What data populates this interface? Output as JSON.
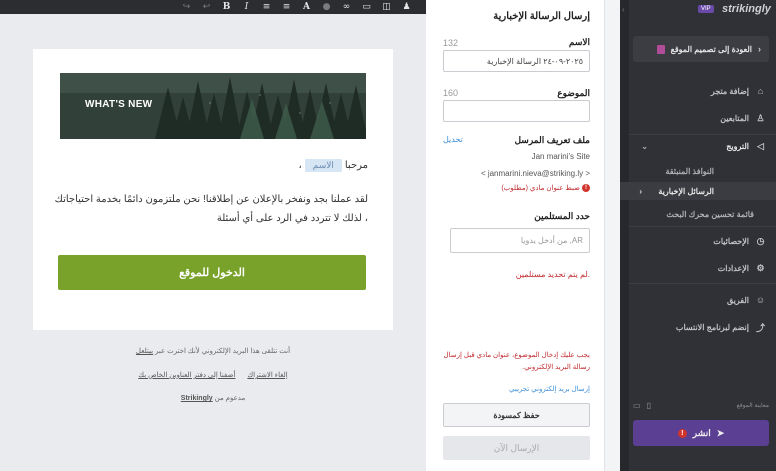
{
  "editor": {
    "toolbar": {
      "icons": [
        "person-icon",
        "bucket-icon",
        "button-icon",
        "link-icon",
        "circle-icon",
        "text-color-icon",
        "align-icon",
        "italic-icon",
        "bold-icon",
        "undo-icon",
        "redo-icon"
      ],
      "italic_glyph": "I",
      "bold_glyph": "B"
    },
    "email": {
      "banner_title": "WHAT'S NEW",
      "greeting": "مرحبا",
      "name_token": "الاسم",
      "body_line1": "لقد عملنا بجد ونفخر بالإعلان عن إطلاقنا! نحن ملتزمون دائمًا بخدمة احتياجاتك",
      "body_line2": "، لذلك لا تتردد في الرد على أي أسئلة",
      "cta_label": "الدخول للموقع"
    },
    "footer": {
      "line1_text": "أنت تتلقى هذا البريد الإلكتروني لأنك اخترت عبر",
      "line1_link": "بيتلعل",
      "unsubscribe": "إلغاء الاشتراك",
      "add_address": "أضفنا إلى دفتر العناوين الخاص بك",
      "powered_text": "مدعوم من",
      "powered_link": "Strikingly"
    }
  },
  "panel": {
    "title": "إرسال الرسالة الإخبارية",
    "name_label": "الاسم",
    "name_counter": "132",
    "name_value": "٢٠٢٥-٠٩-٢٤ الرسالة الإخبارية",
    "subject_label": "الموضوع",
    "subject_counter": "160",
    "subject_value": "",
    "sender_label": "ملف تعريف المرسل",
    "edit_link": "تحديل",
    "sender_name": "Jan marini's Site",
    "sender_email": "< janmarini.nieva@striking.ly >",
    "sender_warning": "ضبط عنوان مادي (مطلوب)",
    "recipients_label": "حدد المستلمين",
    "recipients_placeholder": "AR, من أدخل يدويا",
    "recipients_error": ".لم يتم تحديد مستلمين",
    "bottom_error": "يجب عليك إدخال الموضوع، عنوان مادي قبل إرسال رسالة البريد الإلكتروني.",
    "test_link": "إرسال بريد إلكتروني تجريبي",
    "save_draft": "حفظ كمسودة",
    "send_now": "الإرسال الآن"
  },
  "sidebar": {
    "logo": "strikingly",
    "vip": "VIP",
    "back_label": "العودة إلى تصميم الموقع",
    "items": {
      "add_store": "إضافة متجر",
      "followers": "المتابعين",
      "promotion": "الترويج",
      "popups": "النوافذ المنبثقة",
      "newsletters": "الرسائل الإخبارية",
      "seo": "قائمة تحسين محرك البحث",
      "stats": "الإحصائيات",
      "settings": "الإعدادات",
      "team": "الفريق",
      "affiliate": "إنضم لبرنامج الانتساب"
    },
    "preview_label": "معاينة الموقع",
    "publish": "انشر"
  },
  "colors": {
    "cta_green": "#79a22a",
    "publish_purple": "#5a3f93",
    "error_red": "#c0282c",
    "link_blue": "#3a8cd6",
    "sidebar_bg": "#2f3136"
  }
}
